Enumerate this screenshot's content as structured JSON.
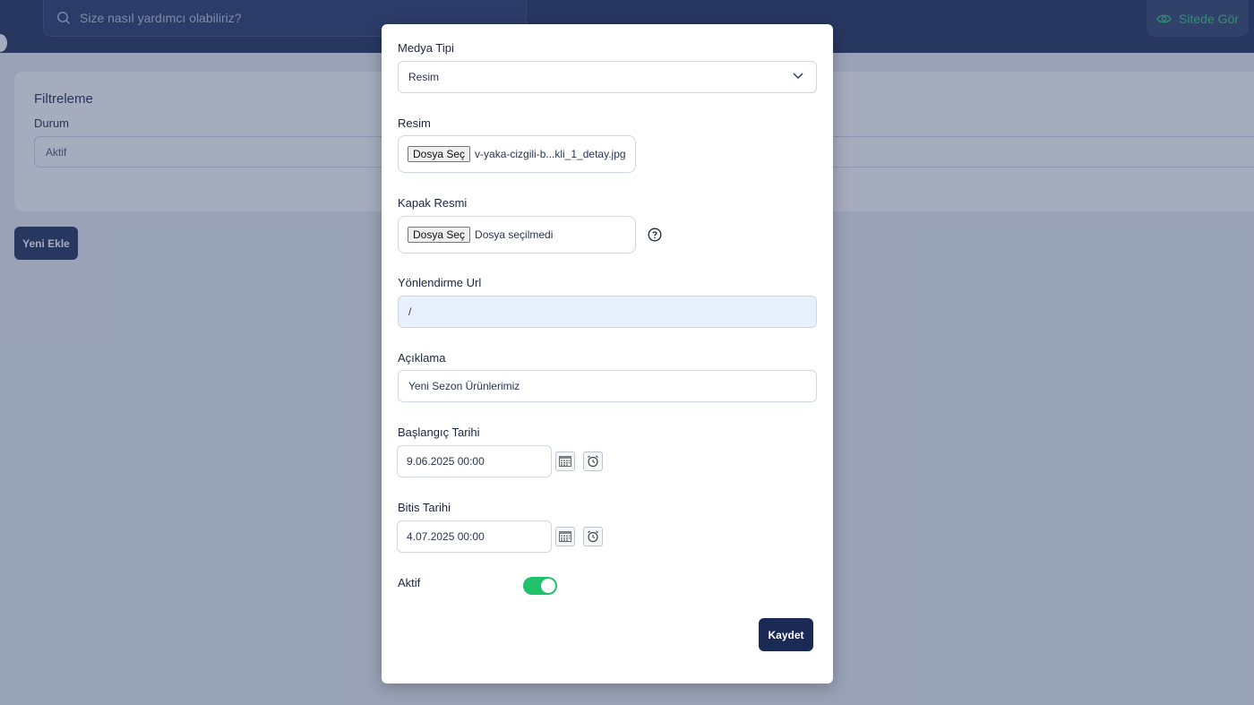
{
  "header": {
    "search_placeholder": "Size nasıl yardımcı olabiliriz?",
    "site_button_label": "Sitede Gör"
  },
  "filter": {
    "title": "Filtreleme",
    "status_label": "Durum",
    "status_value": "Aktif"
  },
  "new_button_label": "Yeni Ekle",
  "modal": {
    "media_type_label": "Medya Tipi",
    "media_type_value": "Resim",
    "image_label": "Resim",
    "image_button": "Dosya Seç",
    "image_file": "v-yaka-cizgili-b...kli_1_detay.jpg",
    "cover_label": "Kapak Resmi",
    "cover_button": "Dosya Seç",
    "cover_file": "Dosya seçilmedi",
    "url_label": "Yönlendirme Url",
    "url_value": "/",
    "description_label": "Açıklama",
    "description_value": "Yeni Sezon Ürünlerimiz",
    "start_label": "Başlangıç Tarihi",
    "start_value": "9.06.2025 00:00",
    "end_label": "Bitis Tarihi",
    "end_value": "4.07.2025 00:00",
    "active_label": "Aktif",
    "active_on": true,
    "save_label": "Kaydet"
  },
  "colors": {
    "primary": "#1b2a55",
    "toggle_on": "#1fc16b",
    "site_button_text": "#2ecc71"
  }
}
